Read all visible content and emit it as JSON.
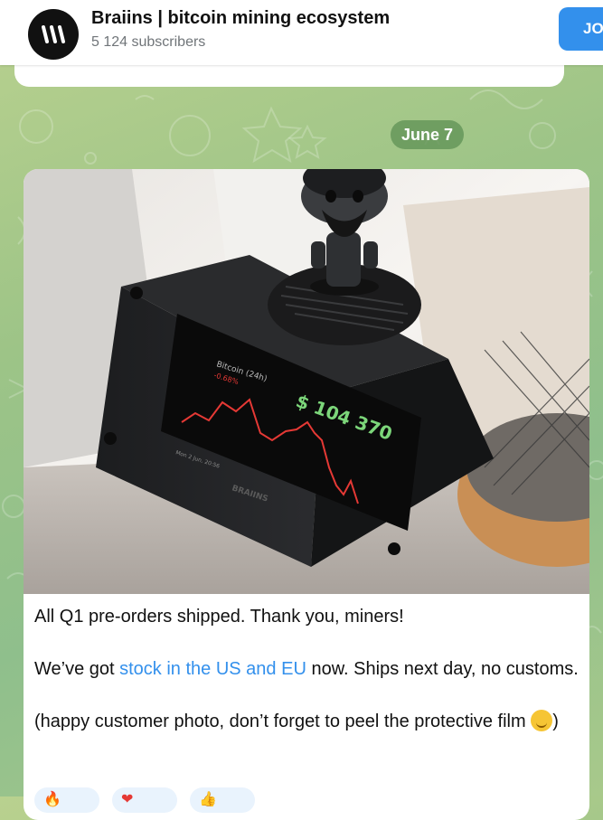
{
  "header": {
    "channel_title": "Braiins | bitcoin mining ecosystem",
    "subscribers": "5 124 subscribers",
    "join_label": "JOIN",
    "avatar_glyph": "\\\\\\"
  },
  "feed": {
    "date_label": "June 7"
  },
  "post": {
    "photo": {
      "screen_title": "Bitcoin (24h)",
      "screen_change": "-0.68%",
      "screen_price": "$ 104 370",
      "screen_timestamp": "Mon 2 Jun, 20:56",
      "device_brand": "BRAIINS"
    },
    "line1": "All Q1 pre-orders shipped. Thank you, miners!",
    "line2_before": "We’ve got ",
    "line2_link": "stock in the US and EU",
    "line2_after": " now. Ships next day, no customs.",
    "line3_before": "(happy customer photo, don’t forget to peel the protective film ",
    "line3_after": ")",
    "emoji_icon": "melting-face-icon",
    "reactions": [
      {
        "icon": "fire-icon",
        "glyph": "🔥",
        "count": ""
      },
      {
        "icon": "heart-icon",
        "glyph": "❤",
        "count": ""
      },
      {
        "icon": "thumbs-up-icon",
        "glyph": "👍",
        "count": ""
      }
    ]
  },
  "colors": {
    "accent": "#3390ec",
    "date_pill": "#609256",
    "chart_line": "#e53935",
    "price_green": "#7cd67a"
  }
}
